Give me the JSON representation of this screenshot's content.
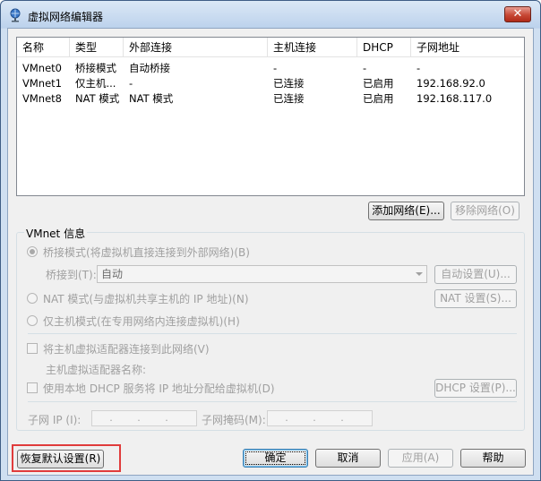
{
  "window": {
    "title": "虚拟网络编辑器",
    "close_label": "✕"
  },
  "list": {
    "columns": [
      "名称",
      "类型",
      "外部连接",
      "主机连接",
      "DHCP",
      "子网地址"
    ],
    "rows": [
      [
        "VMnet0",
        "桥接模式",
        "自动桥接",
        "-",
        "-",
        "-"
      ],
      [
        "VMnet1",
        "仅主机...",
        "-",
        "已连接",
        "已启用",
        "192.168.92.0"
      ],
      [
        "VMnet8",
        "NAT 模式",
        "NAT 模式",
        "已连接",
        "已启用",
        "192.168.117.0"
      ]
    ]
  },
  "list_buttons": {
    "add": "添加网络(E)...",
    "remove": "移除网络(O)"
  },
  "vmnet_info": {
    "group_title": "VMnet 信息",
    "bridge_radio": "桥接模式(将虚拟机直接连接到外部网络)(B)",
    "bridge_to_label": "桥接到(T):",
    "bridge_to_value": "自动",
    "auto_settings": "自动设置(U)...",
    "nat_radio": "NAT 模式(与虚拟机共享主机的 IP 地址)(N)",
    "nat_settings": "NAT 设置(S)...",
    "hostonly_radio": "仅主机模式(在专用网络内连接虚拟机)(H)",
    "connect_adapter_check": "将主机虚拟适配器连接到此网络(V)",
    "adapter_name_label": "主机虚拟适配器名称:",
    "dhcp_check": "使用本地 DHCP 服务将 IP 地址分配给虚拟机(D)",
    "dhcp_settings": "DHCP 设置(P)...",
    "subnet_ip_label": "子网 IP (I):",
    "subnet_ip_value": ". . .",
    "subnet_mask_label": "子网掩码(M):",
    "subnet_mask_value": ". . ."
  },
  "footer": {
    "restore": "恢复默认设置(R)",
    "ok": "确定",
    "cancel": "取消",
    "apply": "应用(A)",
    "help": "帮助"
  },
  "colors": {
    "highlight": "#e03c3c"
  }
}
